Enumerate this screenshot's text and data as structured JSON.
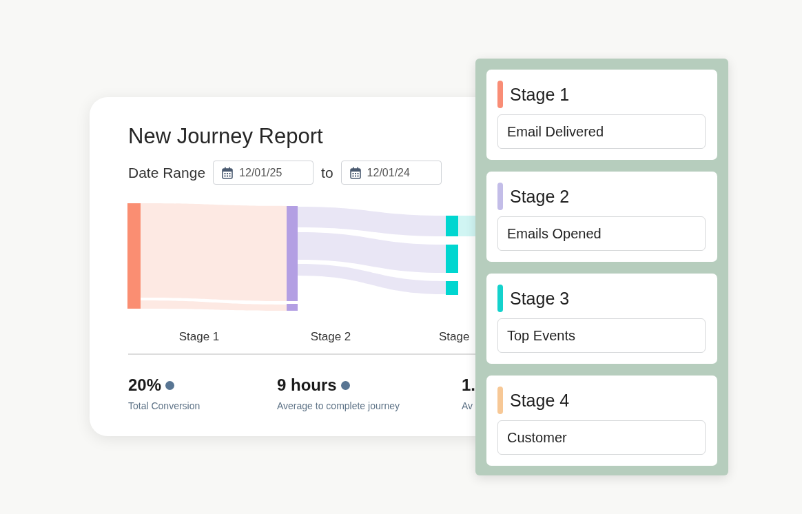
{
  "report": {
    "title": "New Journey Report",
    "date_range": {
      "label": "Date Range",
      "start": "12/01/25",
      "separator": "to",
      "end": "12/01/24"
    },
    "stage_labels": [
      "Stage 1",
      "Stage 2",
      "Stage"
    ],
    "stats": [
      {
        "value": "20%",
        "label": "Total Conversion",
        "info_dot": true
      },
      {
        "value": "9 hours",
        "label": "Average to complete journey",
        "info_dot": true
      },
      {
        "value": "1.",
        "label": "Av",
        "info_dot": false
      }
    ]
  },
  "stages": [
    {
      "title": "Stage 1",
      "color": "#f98d76",
      "event": "Email Delivered"
    },
    {
      "title": "Stage 2",
      "color": "#c3bde8",
      "event": "Emails Opened"
    },
    {
      "title": "Stage 3",
      "color": "#14d2cc",
      "event": "Top Events"
    },
    {
      "title": "Stage 4",
      "color": "#f7c896",
      "event": "Customer"
    }
  ]
}
